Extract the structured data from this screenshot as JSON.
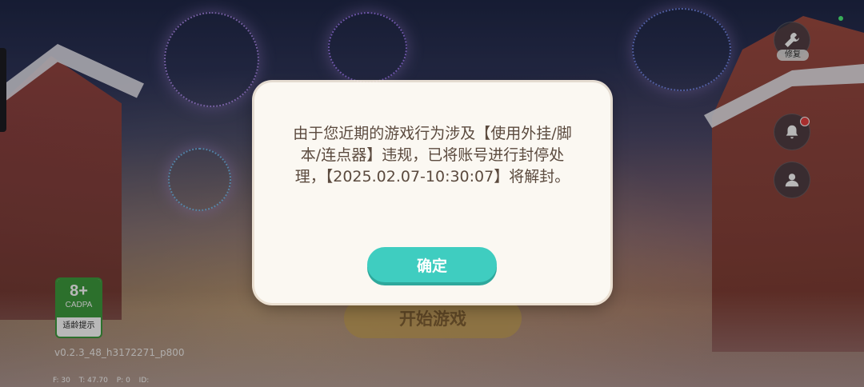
{
  "dialog": {
    "message": "由于您近期的游戏行为涉及【使用外挂/脚本/连点器】违规，已将账号进行封停处理，【2025.02.07-10:30:07】将解封。",
    "confirm_label": "确定"
  },
  "main": {
    "start_label": "开始游戏"
  },
  "side_buttons": {
    "repair_label": "修复"
  },
  "age_rating": {
    "age": "8+",
    "org": "CADPA",
    "hint": "适龄提示"
  },
  "footer": {
    "version": "v0.2.3_48_h3172271_p800",
    "debug": {
      "f": "F: 30",
      "t": "T: 47.70",
      "p": "P: 0",
      "id": "ID:"
    }
  },
  "colors": {
    "confirm": "#3fcdc0",
    "age_green": "#3d9b3d",
    "notify": "#e84040",
    "status": "#4ef07a"
  }
}
